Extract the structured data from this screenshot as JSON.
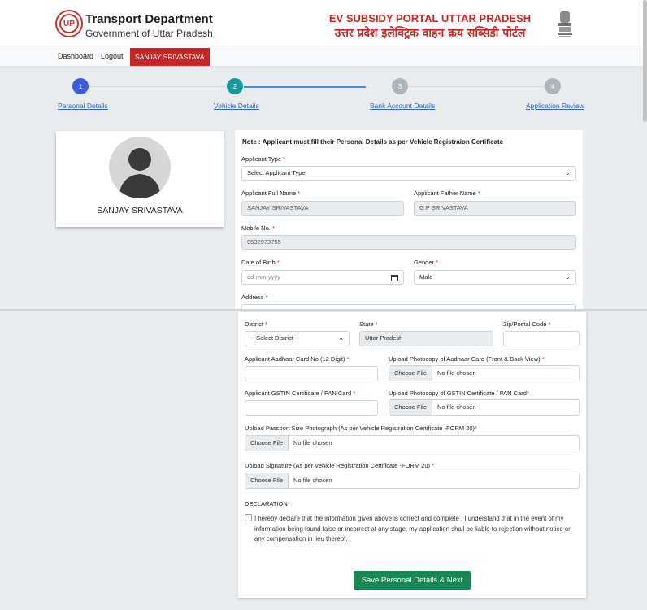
{
  "header": {
    "logo_text": "UP",
    "dept_title": "Transport Department",
    "dept_sub": "Government of Uttar Pradesh",
    "portal_title": "EV SUBSIDY PORTAL UTTAR PRADESH",
    "portal_sub": "उत्तर प्रदेश इलेक्ट्रिक वाहन क्रय सब्सिडी पोर्टल"
  },
  "nav": {
    "dashboard": "Dashboard",
    "logout": "Logout",
    "user": "SANJAY SRIVASTAVA"
  },
  "steps": [
    {
      "num": "1",
      "label": "Personal Details"
    },
    {
      "num": "2",
      "label": "Vehicle Details"
    },
    {
      "num": "3",
      "label": "Bank Account Details"
    },
    {
      "num": "4",
      "label": "Application Review"
    }
  ],
  "profile": {
    "name": "SANJAY SRIVASTAVA"
  },
  "form": {
    "note": "Note : Applicant must fill their Personal Details as per Vehicle Registraion Certificate",
    "applicant_type_label": "Applicant Type",
    "applicant_type_value": "Select Applicant Type",
    "full_name_label": "Applicant Full Name",
    "full_name_value": "SANJAY SRIVASTAVA",
    "father_name_label": "Applicant Father Name",
    "father_name_value": "G.P SRIVASTAVA",
    "mobile_label": "Mobile No.",
    "mobile_value": "9532973755",
    "dob_label": "Date of Birth",
    "dob_placeholder": "dd-mm-yyyy",
    "gender_label": "Gender",
    "gender_value": "Male",
    "address_label": "Address",
    "district_label": "District",
    "district_value": "-- Select District --",
    "state_label": "State",
    "state_value": "Uttar Pradesh",
    "zip_label": "Zip/Postal Code",
    "aadhaar_label": "Applicant Aadhaar Card No (12 Digit)",
    "aadhaar_upload_label": "Upload Photocopy of Aadhaar Card (Front & Back View)",
    "gstin_label": "Applicant GSTIN Certificate / PAN Card",
    "gstin_upload_label": "Upload Photocopy of GSTIN Certificate / PAN Card",
    "photo_upload_label": "Upload Passport Size Photograph (As per Vehicle Registration Certificate -FORM 20)",
    "signature_upload_label": "Upload Signature (As per Vehicle Registration Certificate -FORM 20)",
    "choose_file": "Choose File",
    "no_file": "No file chosen",
    "declaration_label": "DECLARATION",
    "declaration_text": "I hereby declare that the information given above is correct and complete . I understand that in the event of my information being found false or incorrect at any stage, my application shall be liable to rejection without notice or any compensation in lieu thereof.",
    "save_button": "Save Personal Details & Next",
    "required_mark": "*"
  },
  "colors": {
    "brand_red": "#c62828",
    "step_active": "#3b5bdb",
    "step_current": "#1c9a9a",
    "step_inactive": "#adb5bd",
    "save_green": "#198754"
  }
}
